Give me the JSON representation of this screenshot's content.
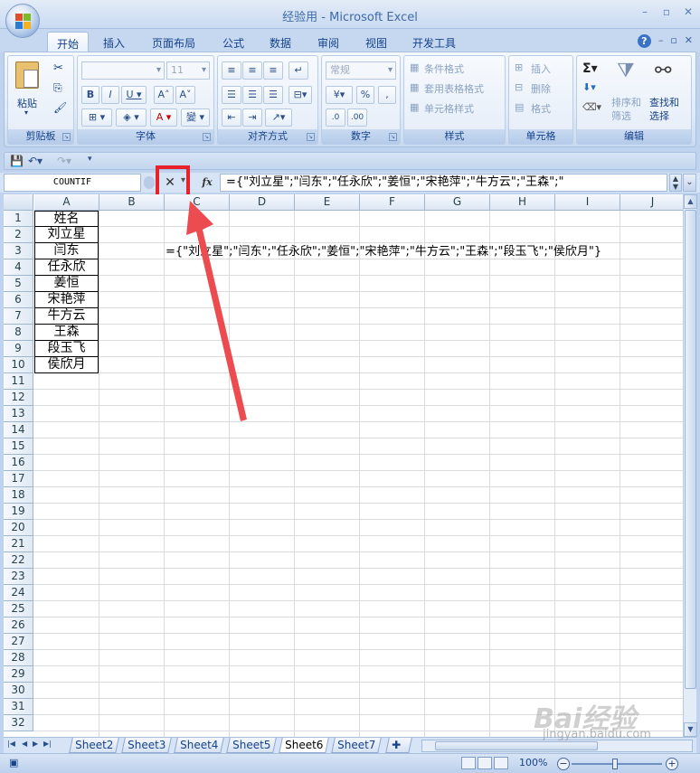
{
  "window": {
    "title": "经验用 - Microsoft Excel"
  },
  "tabs": [
    "开始",
    "插入",
    "页面布局",
    "公式",
    "数据",
    "审阅",
    "视图",
    "开发工具"
  ],
  "ribbon": {
    "clipboard": {
      "label": "剪贴板",
      "paste": "粘贴"
    },
    "font": {
      "label": "字体",
      "font_size": "11"
    },
    "alignment": {
      "label": "对齐方式"
    },
    "number": {
      "label": "数字",
      "format": "常规"
    },
    "styles": {
      "label": "样式",
      "conditional": "条件格式",
      "table": "套用表格格式",
      "cell": "单元格样式"
    },
    "cells": {
      "label": "单元格",
      "insert": "插入",
      "delete": "删除",
      "format": "格式"
    },
    "editing": {
      "label": "编辑",
      "sort": "排序和",
      "sort2": "筛选",
      "find": "查找和",
      "find2": "选择"
    }
  },
  "formula_bar": {
    "name_box": "COUNTIF",
    "formula": "={\"刘立星\";\"闫东\";\"任永欣\";\"姜恒\";\"宋艳萍\";\"牛方云\";\"王森\";\""
  },
  "columns": [
    "A",
    "B",
    "C",
    "D",
    "E",
    "F",
    "G",
    "H",
    "I",
    "J"
  ],
  "rows": [
    "1",
    "2",
    "3",
    "4",
    "5",
    "6",
    "7",
    "8",
    "9",
    "10",
    "11",
    "12",
    "13",
    "14",
    "15",
    "16",
    "17",
    "18",
    "19",
    "20",
    "21",
    "22",
    "23",
    "24",
    "25",
    "26",
    "27",
    "28",
    "29",
    "30",
    "31",
    "32"
  ],
  "cells_A": [
    "姓名",
    "刘立星",
    "闫东",
    "任永欣",
    "姜恒",
    "宋艳萍",
    "牛方云",
    "王森",
    "段玉飞",
    "侯欣月"
  ],
  "cell_C3": "={\"刘立星\";\"闫东\";\"任永欣\";\"姜恒\";\"宋艳萍\";\"牛方云\";\"王森\";\"段玉飞\";\"侯欣月\"}",
  "sheets": [
    "Sheet2",
    "Sheet3",
    "Sheet4",
    "Sheet5",
    "Sheet6",
    "Sheet7"
  ],
  "active_sheet": "Sheet6",
  "status": {
    "zoom": "100%"
  },
  "watermark": {
    "brand": "Bai经验",
    "url": "jingyan.baidu.com"
  }
}
